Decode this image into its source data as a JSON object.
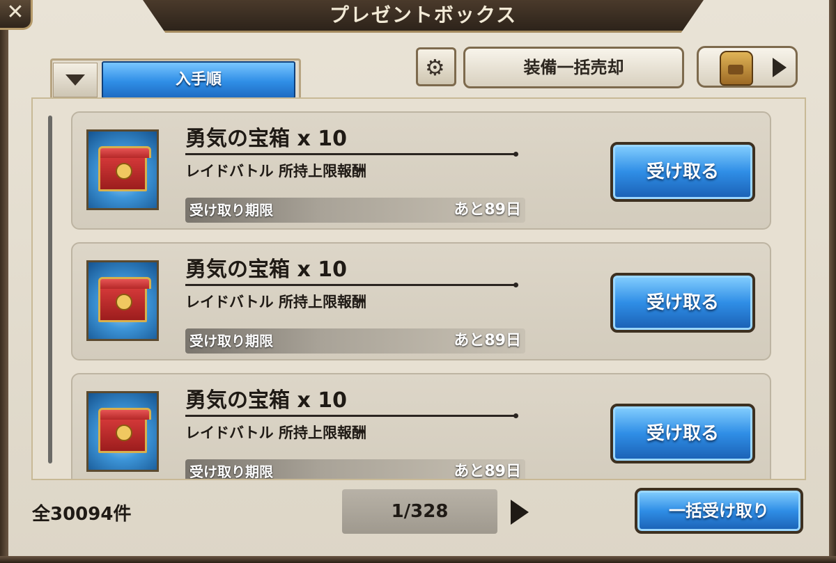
{
  "window": {
    "title": "プレゼントボックス",
    "close_label": "✕"
  },
  "toolbar": {
    "sort_label": "入手順",
    "settings_icon": "gear-icon",
    "sell_label": "装備一括売却",
    "bag_icon": "backpack-icon"
  },
  "presents": [
    {
      "name": "勇気の宝箱 x 10",
      "source": "レイドバトル 所持上限報酬",
      "deadline_label": "受け取り期限",
      "deadline_value": "あと89日",
      "button": "受け取る"
    },
    {
      "name": "勇気の宝箱 x 10",
      "source": "レイドバトル 所持上限報酬",
      "deadline_label": "受け取り期限",
      "deadline_value": "あと89日",
      "button": "受け取る"
    },
    {
      "name": "勇気の宝箱 x 10",
      "source": "レイドバトル 所持上限報酬",
      "deadline_label": "受け取り期限",
      "deadline_value": "あと89日",
      "button": "受け取る"
    }
  ],
  "footer": {
    "total": "全30094件",
    "page": "1/328",
    "receive_all": "一括受け取り"
  }
}
